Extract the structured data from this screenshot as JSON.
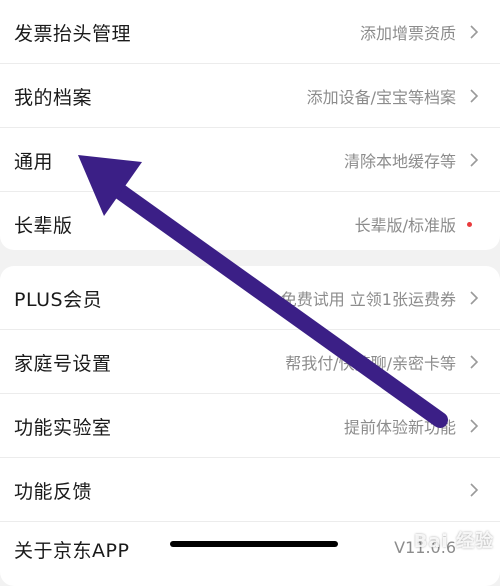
{
  "group1": {
    "rows": [
      {
        "label": "发票抬头管理",
        "value": "添加增票资质"
      },
      {
        "label": "我的档案",
        "value": "添加设备/宝宝等档案"
      },
      {
        "label": "通用",
        "value": "清除本地缓存等"
      },
      {
        "label": "长辈版",
        "value": "长辈版/标准版"
      }
    ]
  },
  "group2": {
    "rows": [
      {
        "label": "PLUS会员",
        "value": "免费试用 立领1张运费券"
      },
      {
        "label": "家庭号设置",
        "value": "帮我付/快捷聊/亲密卡等"
      },
      {
        "label": "功能实验室",
        "value": "提前体验新功能"
      },
      {
        "label": "功能反馈",
        "value": ""
      },
      {
        "label": "关于京东APP",
        "value": "V11.0.6"
      }
    ]
  },
  "watermark": {
    "text": "Bai 经验"
  },
  "colors": {
    "accent_red": "#e93b3d",
    "annotation_arrow": "#3b1f86"
  },
  "icons": {
    "chevron": "chevron-right-icon",
    "new_dot": "red-dot-icon"
  }
}
